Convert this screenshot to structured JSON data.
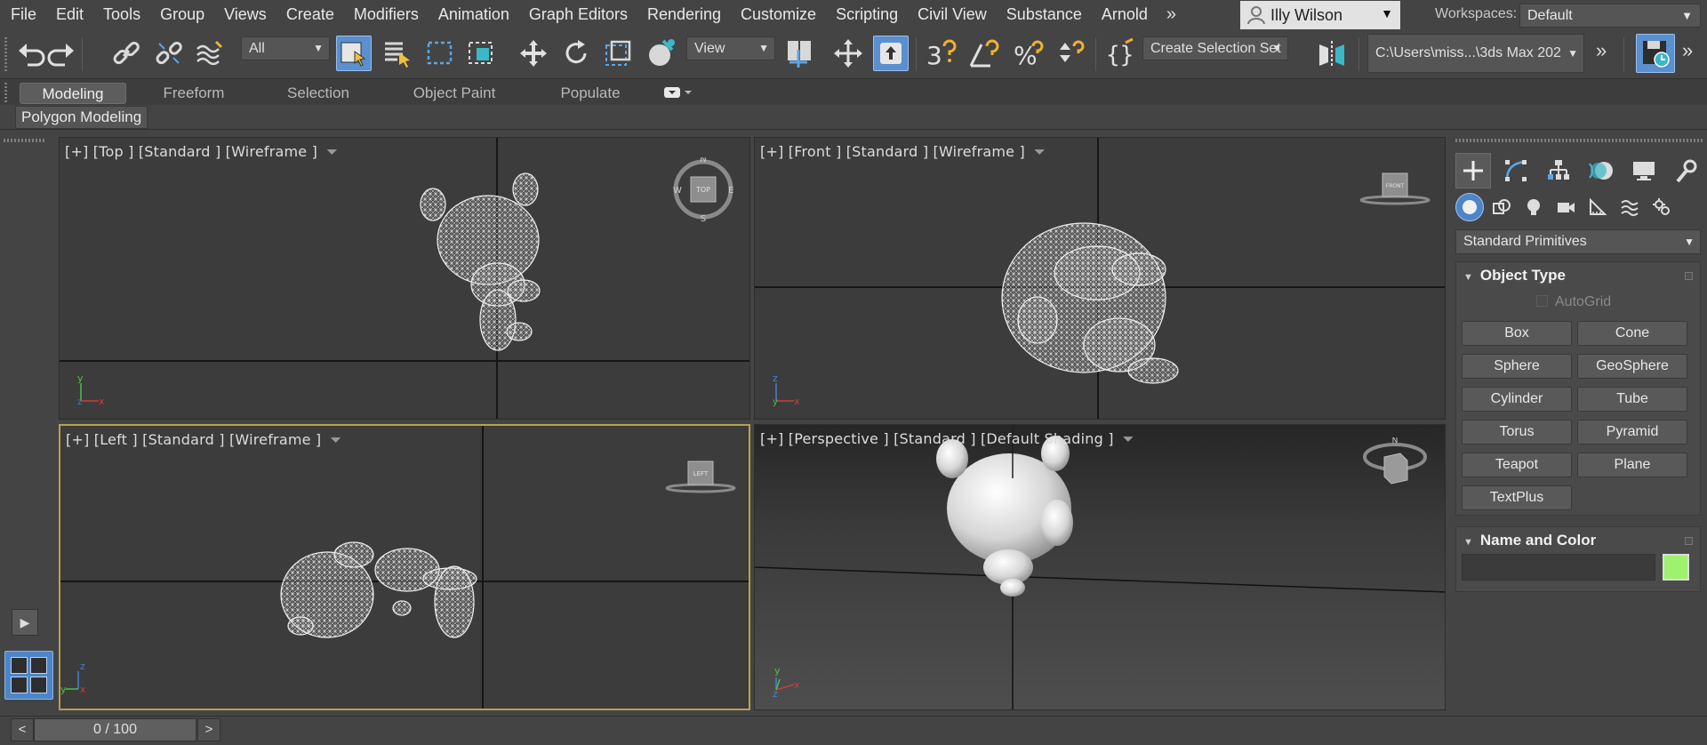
{
  "menubar": {
    "items": [
      "File",
      "Edit",
      "Tools",
      "Group",
      "Views",
      "Create",
      "Modifiers",
      "Animation",
      "Graph Editors",
      "Rendering",
      "Customize",
      "Scripting",
      "Civil View",
      "Substance",
      "Arnold"
    ],
    "more": "»",
    "user": "Illy Wilson",
    "workspaces_label": "Workspaces:",
    "workspace": "Default"
  },
  "toolbar": {
    "filter": "All",
    "ref_coord": "View",
    "selection_set": "Create Selection Set",
    "project_path": "C:\\Users\\miss...\\3ds Max 202",
    "more": "»"
  },
  "ribbon": {
    "tabs": [
      "Modeling",
      "Freeform",
      "Selection",
      "Object Paint",
      "Populate"
    ],
    "active_tab": "Modeling",
    "panel": "Polygon Modeling"
  },
  "viewports": {
    "top": {
      "label": "[+] [Top ] [Standard ] [Wireframe ]",
      "cube": "TOP"
    },
    "front": {
      "label": "[+] [Front ] [Standard ] [Wireframe ]",
      "cube": "FRONT"
    },
    "left": {
      "label": "[+] [Left ] [Standard ] [Wireframe ]",
      "cube": "LEFT"
    },
    "perspective": {
      "label": "[+] [Perspective ] [Standard ] [Default Shading ]"
    }
  },
  "command_panel": {
    "category": "Standard Primitives",
    "object_type": {
      "title": "Object Type",
      "autogrid": "AutoGrid",
      "buttons": [
        "Box",
        "Cone",
        "Sphere",
        "GeoSphere",
        "Cylinder",
        "Tube",
        "Torus",
        "Pyramid",
        "Teapot",
        "Plane",
        "TextPlus"
      ]
    },
    "name_color": {
      "title": "Name and Color",
      "color": "#9ef26d"
    }
  },
  "timeline": {
    "frame": "0 / 100",
    "prev": "<",
    "next": ">"
  },
  "colors": {
    "accent": "#4d86c8",
    "selected_border": "#b8a24a",
    "background": "#444444",
    "viewport": "#3c3c3c"
  }
}
